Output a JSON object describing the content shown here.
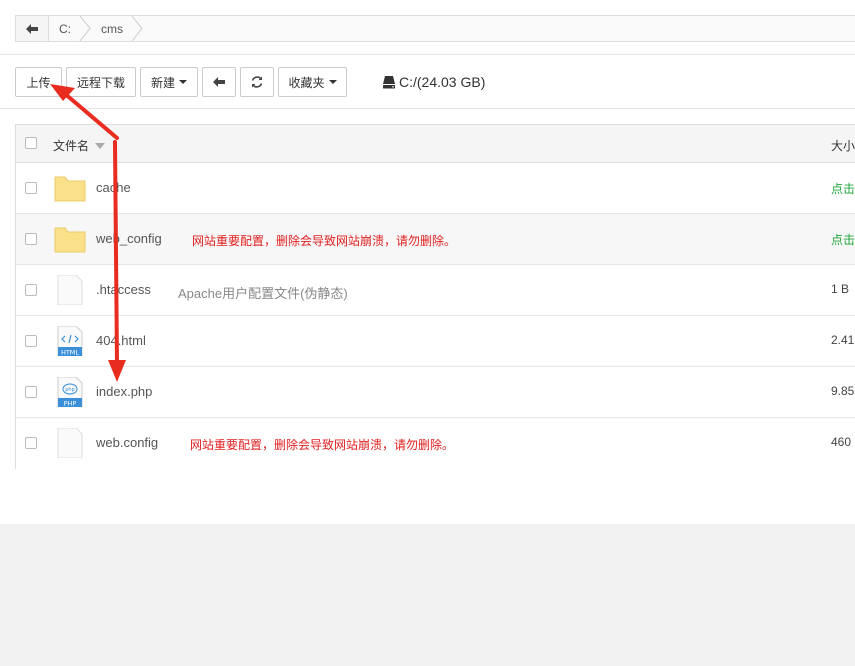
{
  "breadcrumb": {
    "back_icon": "arrow-left-icon",
    "items": [
      "C:",
      "cms"
    ]
  },
  "toolbar": {
    "upload_label": "上传",
    "remote_download_label": "远程下载",
    "new_label": "新建",
    "back_icon": "arrow-left-icon",
    "refresh_icon": "refresh-icon",
    "favorites_label": "收藏夹"
  },
  "disk": {
    "icon": "drive-icon",
    "label": "C:/(24.03 GB)"
  },
  "table": {
    "header": {
      "name": "文件名",
      "size": "大小"
    },
    "rows": [
      {
        "name": "cache",
        "type": "folder",
        "note": "",
        "size": "点击"
      },
      {
        "name": "web_config",
        "type": "folder",
        "note": "网站重要配置，删除会导致网站崩溃，请勿删除。",
        "size": "点击"
      },
      {
        "name": ".htaccess",
        "type": "file",
        "note": "Apache用户配置文件(伪静态)",
        "size": "1 B"
      },
      {
        "name": "404.html",
        "type": "html",
        "note": "",
        "size": "2.41"
      },
      {
        "name": "index.php",
        "type": "php",
        "note": "",
        "size": "9.85"
      },
      {
        "name": "web.config",
        "type": "file",
        "note": "网站重要配置，删除会导致网站崩溃，请勿删除。",
        "size": "460"
      }
    ]
  },
  "colors": {
    "annotation_red": "#e02020",
    "link_green": "#20a53a",
    "folder_yellow": "#fbe08a"
  }
}
